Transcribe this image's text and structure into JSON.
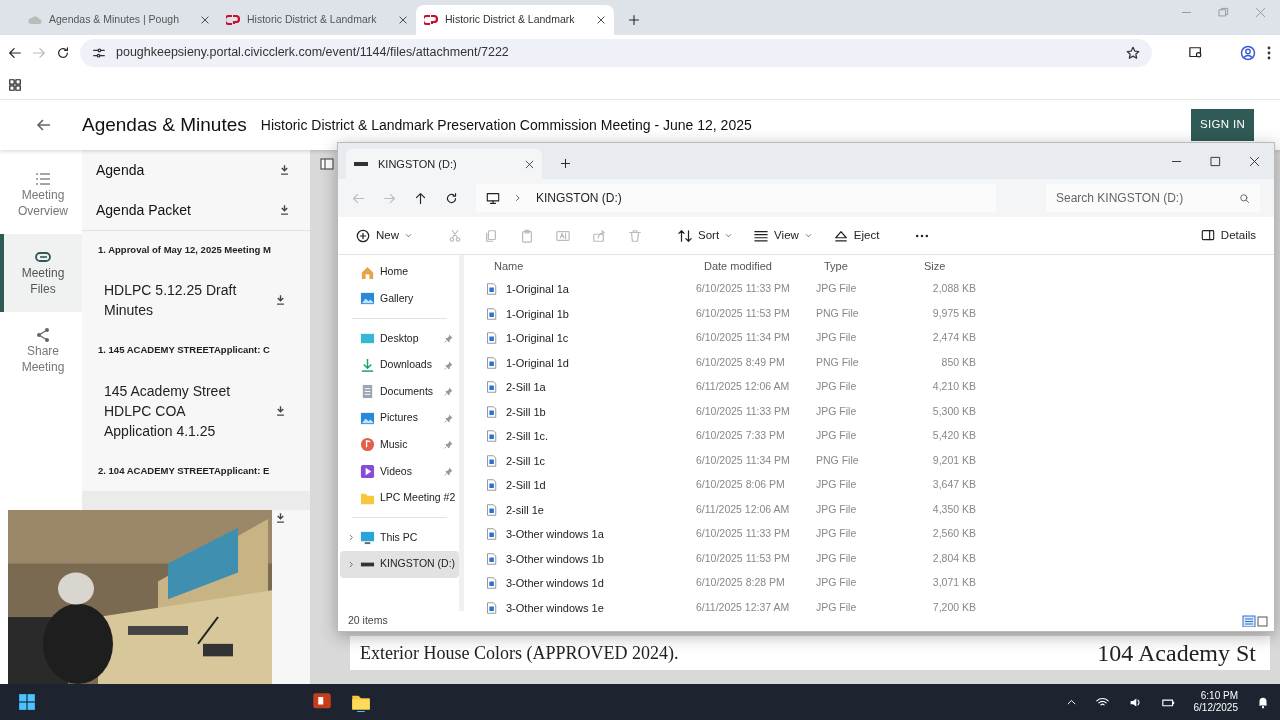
{
  "browser": {
    "tabs": [
      {
        "label": "Agendas & Minutes | Pough",
        "selected": false
      },
      {
        "label": "Historic District & Landmark",
        "selected": false
      },
      {
        "label": "Historic District & Landmark",
        "selected": true
      }
    ],
    "url": "poughkeepsieny.portal.civicclerk.com/event/1144/files/attachment/7222",
    "forward_disabled": true
  },
  "page": {
    "brand": "Agendas & Minutes",
    "title": "Historic District & Landmark Preservation Commission Meeting - June 12, 2025",
    "sign_in": "SIGN IN",
    "nav": [
      {
        "label": "Meeting Overview",
        "selected": false
      },
      {
        "label": "Meeting Files",
        "selected": true
      },
      {
        "label": "Share Meeting",
        "selected": false
      }
    ],
    "files": [
      {
        "kind": "top",
        "label": "Agenda"
      },
      {
        "kind": "top",
        "label": "Agenda Packet"
      },
      {
        "kind": "heading",
        "label": "1. Approval of May 12, 2025 Meeting M"
      },
      {
        "kind": "file",
        "label": "HDLPC 5.12.25 Draft Minutes",
        "selected": false
      },
      {
        "kind": "heading",
        "label": "1. 145 ACADEMY STREETApplicant: C"
      },
      {
        "kind": "file",
        "label": "145 Academy Street HDLPC COA Application 4.1.25",
        "selected": false
      },
      {
        "kind": "heading",
        "label": "2. 104 ACADEMY STREETApplicant: E"
      },
      {
        "kind": "file",
        "selected": true
      }
    ],
    "viewer": {
      "caption": "Exterior House Colors (APPROVED 2024).",
      "address": "104 Academy St"
    }
  },
  "explorer": {
    "tab": "KINGSTON (D:)",
    "back_disabled": true,
    "forward_disabled": true,
    "path": "KINGSTON (D:)",
    "search_placeholder": "Search KINGSTON (D:)",
    "toolbar": [
      {
        "kind": "new",
        "label": "New",
        "disabled": false
      },
      {
        "kind": "cut",
        "disabled": true
      },
      {
        "kind": "copy",
        "disabled": true
      },
      {
        "kind": "paste",
        "disabled": true
      },
      {
        "kind": "rename",
        "disabled": true
      },
      {
        "kind": "share",
        "disabled": true
      },
      {
        "kind": "delete",
        "disabled": true
      },
      {
        "kind": "sort",
        "label": "Sort",
        "disabled": false
      },
      {
        "kind": "view",
        "label": "View",
        "disabled": false
      },
      {
        "kind": "eject",
        "label": "Eject",
        "disabled": false
      },
      {
        "kind": "more",
        "disabled": false
      }
    ],
    "details": "Details",
    "nav": [
      {
        "kind": "home",
        "label": "Home",
        "pinned": false,
        "selected": false
      },
      {
        "kind": "gallery",
        "label": "Gallery",
        "pinned": false,
        "selected": false
      },
      {
        "kind": "divider"
      },
      {
        "kind": "desktop",
        "label": "Desktop",
        "pinned": true,
        "selected": false
      },
      {
        "kind": "downloads",
        "label": "Downloads",
        "pinned": true,
        "selected": false
      },
      {
        "kind": "documents",
        "label": "Documents",
        "pinned": true,
        "selected": false
      },
      {
        "kind": "pictures",
        "label": "Pictures",
        "pinned": true,
        "selected": false
      },
      {
        "kind": "music",
        "label": "Music",
        "pinned": true,
        "selected": false
      },
      {
        "kind": "videos",
        "label": "Videos",
        "pinned": true,
        "selected": false
      },
      {
        "kind": "folder",
        "label": "LPC Meeting #2",
        "pinned": false,
        "selected": false
      },
      {
        "kind": "divider"
      },
      {
        "kind": "pc",
        "label": "This PC",
        "pinned": false,
        "selected": false
      },
      {
        "kind": "drive",
        "label": "KINGSTON (D:)",
        "pinned": false,
        "selected": true
      }
    ],
    "columns": [
      "Name",
      "Date modified",
      "Type",
      "Size"
    ],
    "rows": [
      [
        "1-Original 1a",
        "6/10/2025 11:33 PM",
        "JPG File",
        "2,088 KB"
      ],
      [
        "1-Original 1b",
        "6/10/2025 11:53 PM",
        "PNG File",
        "9,975 KB"
      ],
      [
        "1-Original 1c",
        "6/10/2025 11:34 PM",
        "JPG File",
        "2,474 KB"
      ],
      [
        "1-Original 1d",
        "6/10/2025 8:49 PM",
        "PNG File",
        "850 KB"
      ],
      [
        "2-Sill 1a",
        "6/11/2025 12:06 AM",
        "JPG File",
        "4,210 KB"
      ],
      [
        "2-Sill 1b",
        "6/10/2025 11:33 PM",
        "JPG File",
        "5,300 KB"
      ],
      [
        "2-Sill 1c.",
        "6/10/2025 7:33 PM",
        "JPG File",
        "5,420 KB"
      ],
      [
        "2-Sill 1c",
        "6/10/2025 11:34 PM",
        "PNG File",
        "9,201 KB"
      ],
      [
        "2-Sill 1d",
        "6/10/2025 8:06 PM",
        "JPG File",
        "3,647 KB"
      ],
      [
        "2-sill 1e",
        "6/11/2025 12:06 AM",
        "JPG File",
        "4,350 KB"
      ],
      [
        "3-Other windows 1a",
        "6/10/2025 11:33 PM",
        "JPG File",
        "2,560 KB"
      ],
      [
        "3-Other windows 1b",
        "6/10/2025 11:53 PM",
        "JPG File",
        "2,804 KB"
      ],
      [
        "3-Other windows 1d",
        "6/10/2025 8:28 PM",
        "JPG File",
        "3,071 KB"
      ],
      [
        "3-Other windows 1e",
        "6/11/2025 12:37 AM",
        "JPG File",
        "7,200 KB"
      ]
    ],
    "status": "20 items"
  },
  "taskbar": {
    "apps": [
      {
        "kind": "powerpoint",
        "active": false
      },
      {
        "kind": "explorer",
        "active": true
      }
    ],
    "time": "6:10 PM",
    "date": "6/12/2025"
  }
}
